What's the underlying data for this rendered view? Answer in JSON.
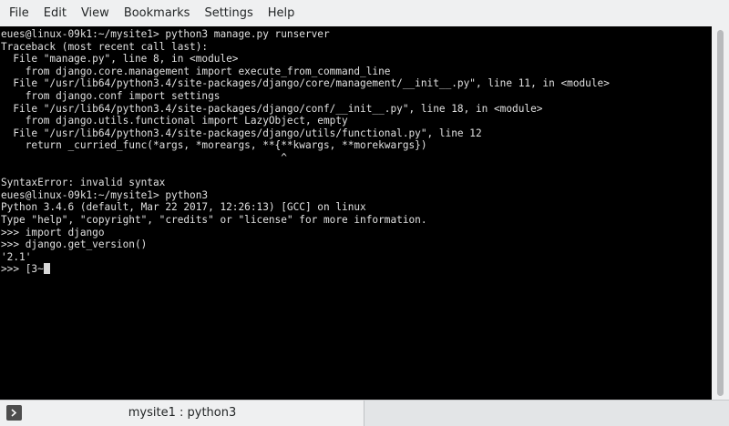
{
  "menubar": {
    "items": [
      "File",
      "Edit",
      "View",
      "Bookmarks",
      "Settings",
      "Help"
    ]
  },
  "terminal": {
    "lines": [
      "eues@linux-09k1:~/mysite1> python3 manage.py runserver",
      "Traceback (most recent call last):",
      "  File \"manage.py\", line 8, in <module>",
      "    from django.core.management import execute_from_command_line",
      "  File \"/usr/lib64/python3.4/site-packages/django/core/management/__init__.py\", line 11, in <module>",
      "    from django.conf import settings",
      "  File \"/usr/lib64/python3.4/site-packages/django/conf/__init__.py\", line 18, in <module>",
      "    from django.utils.functional import LazyObject, empty",
      "  File \"/usr/lib64/python3.4/site-packages/django/utils/functional.py\", line 12",
      "    return _curried_func(*args, *moreargs, **{**kwargs, **morekwargs})",
      "                                              ^",
      "",
      "SyntaxError: invalid syntax",
      "eues@linux-09k1:~/mysite1> python3",
      "Python 3.4.6 (default, Mar 22 2017, 12:26:13) [GCC] on linux",
      "Type \"help\", \"copyright\", \"credits\" or \"license\" for more information.",
      ">>> import django",
      ">>> django.get_version()",
      "'2.1'"
    ],
    "current_input": ">>> [3~"
  },
  "tabbar": {
    "tab_label": "mysite1 : python3"
  },
  "icons": {
    "tab_icon": "terminal-prompt-icon"
  },
  "colors": {
    "terminal_bg": "#000000",
    "terminal_fg": "#e0e0e0",
    "window_bg": "#eff0f1"
  }
}
